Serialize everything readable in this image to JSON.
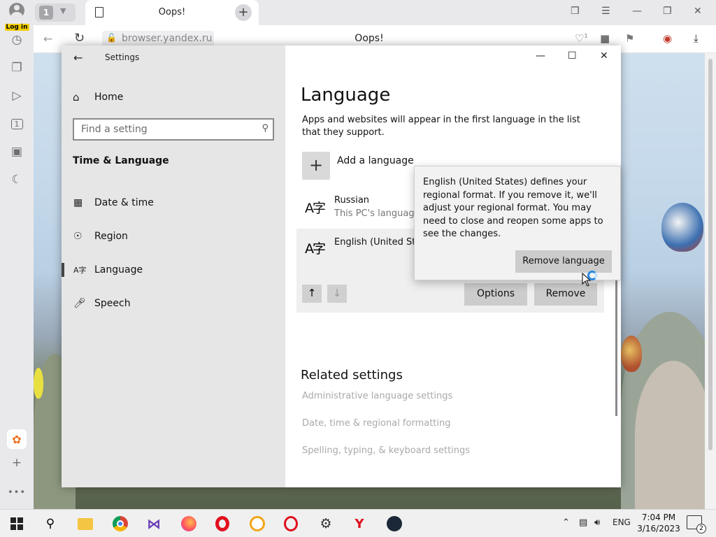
{
  "browser": {
    "login_label": "Log in",
    "tab_count": "1",
    "tab_title": "Oops!",
    "url": "browser.yandex.ru",
    "page_title": "Oops!",
    "notifications_count": "1"
  },
  "settings": {
    "app_title": "Settings",
    "home_label": "Home",
    "search_placeholder": "Find a setting",
    "section_title": "Time & Language",
    "nav": [
      {
        "label": "Date & time",
        "icon": "calendar-clock-icon"
      },
      {
        "label": "Region",
        "icon": "globe-icon"
      },
      {
        "label": "Language",
        "icon": "language-icon"
      },
      {
        "label": "Speech",
        "icon": "microphone-icon"
      }
    ],
    "page_heading": "Language",
    "description": "Apps and websites will appear in the first language in the list that they support.",
    "add_language_label": "Add a language",
    "languages": [
      {
        "name": "Russian",
        "subtitle": "This PC's language"
      },
      {
        "name": "English (United Sta"
      }
    ],
    "options_label": "Options",
    "remove_label": "Remove",
    "related_heading": "Related settings",
    "related_links": [
      "Administrative language settings",
      "Date, time & regional formatting",
      "Spelling, typing, & keyboard settings"
    ],
    "flyout_message": "English (United States) defines your regional format. If you remove it, we'll adjust your regional format. You may need to close and reopen some apps to see the changes.",
    "flyout_button": "Remove language"
  },
  "taskbar": {
    "language": "ENG",
    "time": "7:04 PM",
    "date": "3/16/2023",
    "notification_count": "2"
  },
  "colors": {
    "accent_yellow": "#f2cc00",
    "busy_cursor_blue": "#2a8ae0"
  }
}
